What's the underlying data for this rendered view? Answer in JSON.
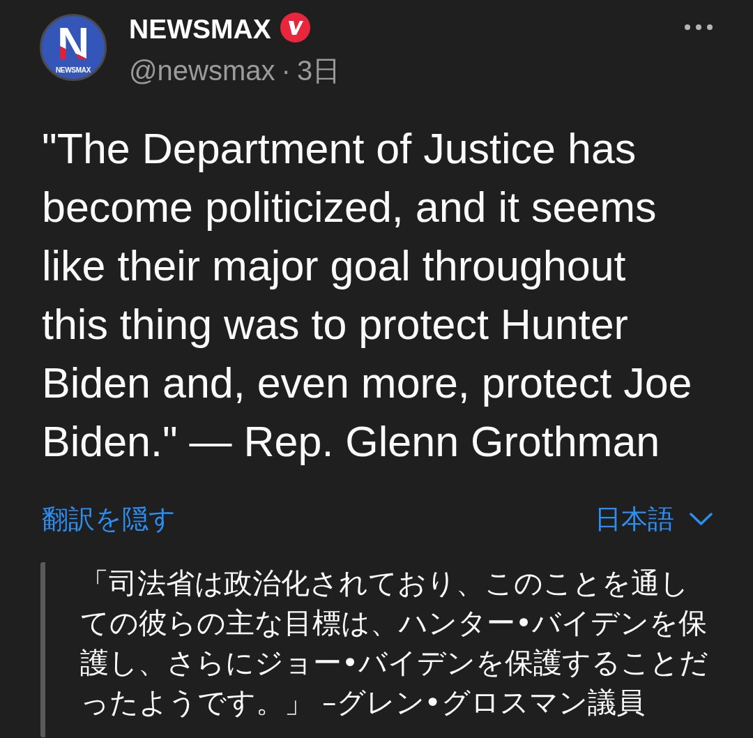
{
  "post": {
    "avatar": {
      "logo_letter": "N",
      "logo_text": "NEWSMAX"
    },
    "author": {
      "name": "NEWSMAX",
      "verified": true,
      "handle": "@newsmax",
      "separator": "·",
      "time": "3日"
    },
    "text": "\"The Department of Justice has become politicized, and it seems like their major goal throughout this thing was to protect Hunter Biden and, even more, protect Joe Biden.\" — Rep. Glenn Grothman",
    "translation": {
      "toggle_label": "翻訳を隠す",
      "language": "日本語",
      "text": "「司法省は政治化されており、このことを通しての彼らの主な目標は、ハンター•バイデンを保護し、さらにジョー•バイデンを保護することだったようです。」 –グレン•グロスマン議員"
    }
  }
}
